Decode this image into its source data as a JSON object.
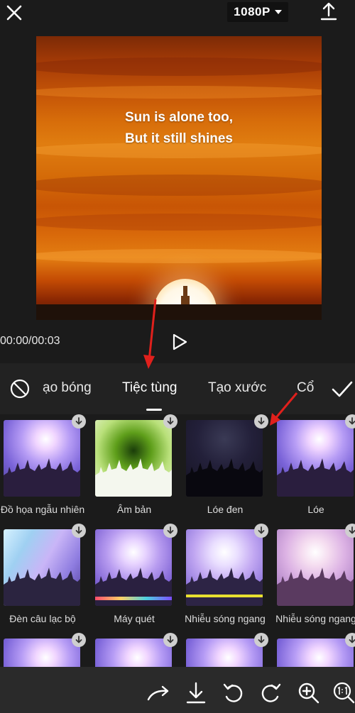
{
  "top_bar": {
    "resolution": "1080P"
  },
  "preview": {
    "caption_line1": "Sun is alone too,",
    "caption_line2": "But it still shines"
  },
  "playback": {
    "time": "00:00/00:03"
  },
  "effect_tabs": [
    {
      "label": "ạo bóng",
      "active": false
    },
    {
      "label": "Tiệc tùng",
      "active": true
    },
    {
      "label": "Tạo xước",
      "active": false
    },
    {
      "label": "Cổ",
      "active": false
    }
  ],
  "effects": [
    {
      "label": "Đồ họa ngẫu nhiên",
      "style": "purple"
    },
    {
      "label": "Âm bản",
      "style": "negative"
    },
    {
      "label": "Lóe đen",
      "style": "dark"
    },
    {
      "label": "Lóe",
      "style": "purple"
    },
    {
      "label": "Đèn câu lạc bộ",
      "style": "rays"
    },
    {
      "label": "Máy quét",
      "style": "scanner"
    },
    {
      "label": "Nhiễu sóng ngang",
      "style": "noise"
    },
    {
      "label": "Nhiễu sóng ngang",
      "style": "pink"
    },
    {
      "label": "",
      "style": "purple"
    },
    {
      "label": "",
      "style": "purple"
    },
    {
      "label": "",
      "style": "purple"
    },
    {
      "label": "",
      "style": "purple"
    }
  ],
  "bottom_toolbar": [
    "redo-arrow-icon",
    "download-icon",
    "undo-icon",
    "redo-icon",
    "zoom-in-icon",
    "aspect-ratio-icon"
  ],
  "colors": {
    "background": "#1b1b1b",
    "annotation_arrow": "#e0201c"
  }
}
